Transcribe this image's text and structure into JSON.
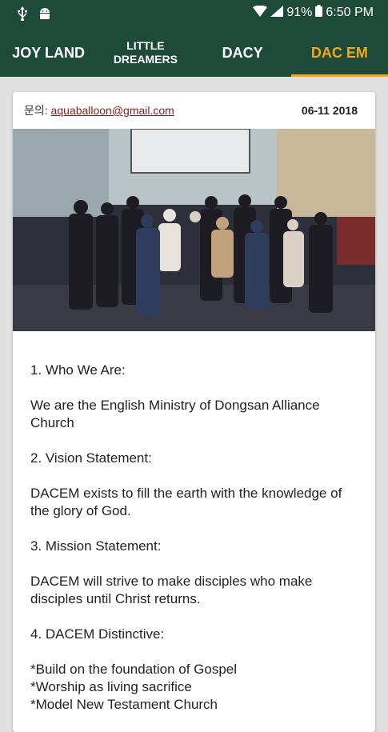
{
  "status": {
    "battery": "91%",
    "time": "6:50 PM"
  },
  "tabs": [
    {
      "label": "JOY LAND"
    },
    {
      "label_line1": "LITTLE",
      "label_line2": "DREAMERS"
    },
    {
      "label": "DACY"
    },
    {
      "label": "DAC EM"
    }
  ],
  "post": {
    "contact_label": "문의: ",
    "email": "aquaballoon@gmail.com",
    "date": "06-11 2018",
    "sections": [
      {
        "heading": "1. Who We Are:",
        "body": "We are the English Ministry of Dongsan Alliance Church"
      },
      {
        "heading": "2. Vision Statement:",
        "body": "DACEM exists to fill the earth with the knowledge of the glory of God."
      },
      {
        "heading": "3. Mission Statement:",
        "body": "DACEM will strive to make disciples who make disciples until Christ returns."
      },
      {
        "heading": "4. DACEM Distinctive:"
      }
    ],
    "distinctives": [
      "*Build on the foundation of Gospel",
      "*Worship as living sacrifice",
      "*Model New Testament Church"
    ]
  },
  "colors": {
    "primary": "#1e4a3a",
    "accent": "#f2a71b",
    "email": "#8b1a1a"
  }
}
